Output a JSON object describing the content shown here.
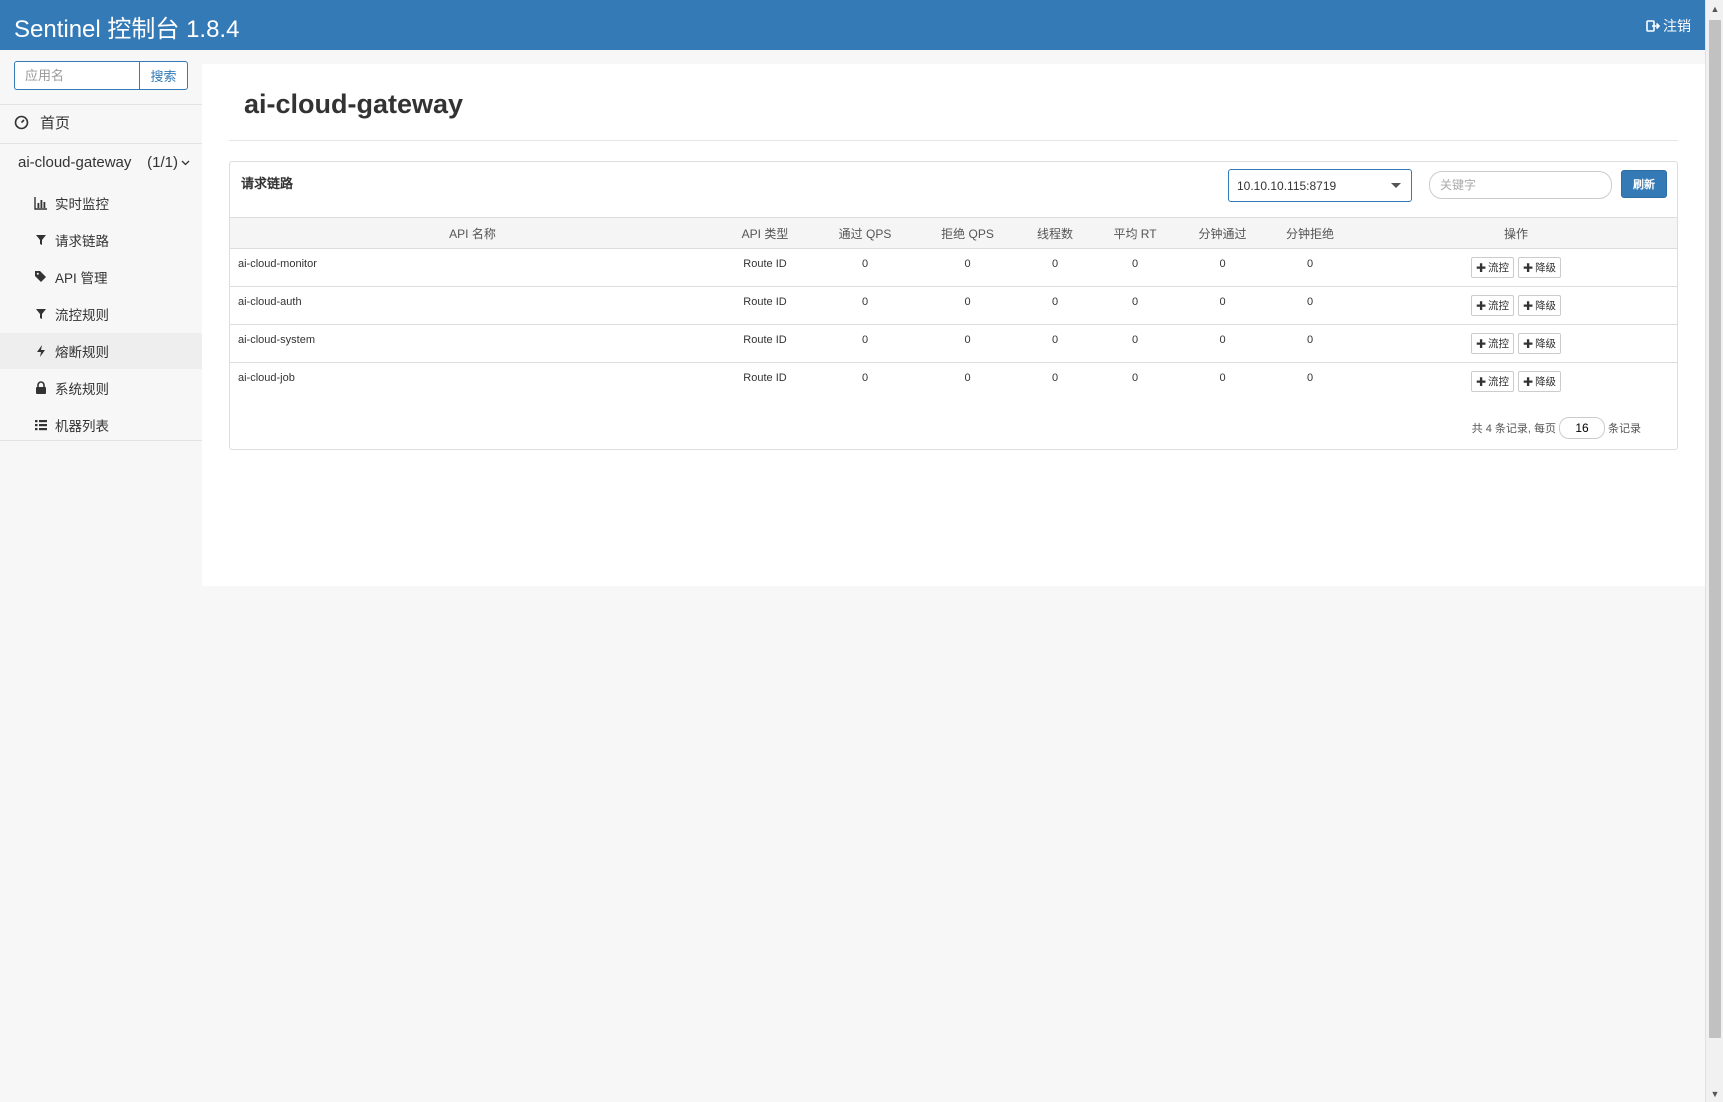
{
  "header": {
    "brand": "Sentinel 控制台 1.8.4",
    "logout_label": "注销"
  },
  "sidebar": {
    "search_placeholder": "应用名",
    "search_button": "搜索",
    "home": "首页",
    "app_name": "ai-cloud-gateway",
    "app_count": "(1/1)",
    "items": [
      {
        "label": "实时监控",
        "icon": "bar-chart-icon"
      },
      {
        "label": "请求链路",
        "icon": "filter-icon"
      },
      {
        "label": "API 管理",
        "icon": "tags-icon"
      },
      {
        "label": "流控规则",
        "icon": "filter-icon"
      },
      {
        "label": "熔断规则",
        "icon": "flash-icon"
      },
      {
        "label": "系统规则",
        "icon": "lock-icon"
      },
      {
        "label": "机器列表",
        "icon": "list-icon"
      }
    ]
  },
  "main": {
    "title": "ai-cloud-gateway",
    "card_title": "请求链路",
    "machine": "10.10.10.115:8719",
    "keyword_placeholder": "关键字",
    "refresh": "刷新",
    "columns": [
      "API 名称",
      "API 类型",
      "通过 QPS",
      "拒绝 QPS",
      "线程数",
      "平均 RT",
      "分钟通过",
      "分钟拒绝",
      "操作"
    ],
    "rows": [
      {
        "name": "ai-cloud-monitor",
        "type": "Route ID",
        "pass_qps": "0",
        "block_qps": "0",
        "threads": "0",
        "avg_rt": "0",
        "min_pass": "0",
        "min_block": "0"
      },
      {
        "name": "ai-cloud-auth",
        "type": "Route ID",
        "pass_qps": "0",
        "block_qps": "0",
        "threads": "0",
        "avg_rt": "0",
        "min_pass": "0",
        "min_block": "0"
      },
      {
        "name": "ai-cloud-system",
        "type": "Route ID",
        "pass_qps": "0",
        "block_qps": "0",
        "threads": "0",
        "avg_rt": "0",
        "min_pass": "0",
        "min_block": "0"
      },
      {
        "name": "ai-cloud-job",
        "type": "Route ID",
        "pass_qps": "0",
        "block_qps": "0",
        "threads": "0",
        "avg_rt": "0",
        "min_pass": "0",
        "min_block": "0"
      }
    ],
    "op_flow": "流控",
    "op_degrade": "降级",
    "pager": {
      "prefix": "共 4 条记录, 每页",
      "page_size": "16",
      "suffix": "条记录"
    }
  },
  "colors": {
    "primary": "#337ab7"
  }
}
